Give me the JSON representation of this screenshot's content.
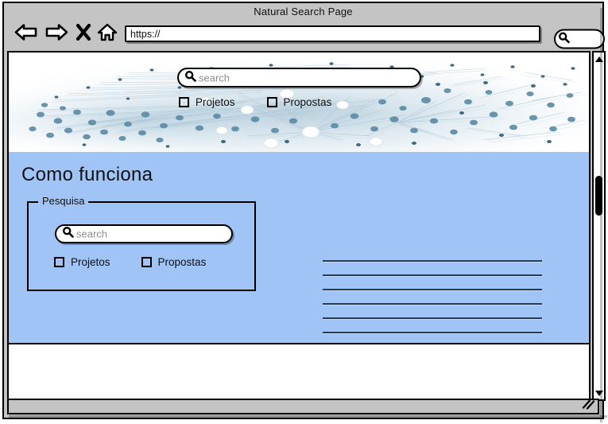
{
  "window": {
    "title": "Natural Search Page"
  },
  "browser_chrome": {
    "back_icon": "back-arrow-icon",
    "forward_icon": "forward-arrow-icon",
    "stop_icon": "close-x-icon",
    "home_icon": "home-icon",
    "url_value": "https://",
    "url_placeholder": "https://",
    "search_icon": "search-icon",
    "search_value": "",
    "search_placeholder": ""
  },
  "hero": {
    "background_image": "network-graph-visualization",
    "search": {
      "icon": "search-icon",
      "value": "",
      "placeholder": "search"
    },
    "checkboxes": [
      {
        "label": "Projetos",
        "checked": false
      },
      {
        "label": "Propostas",
        "checked": false
      }
    ]
  },
  "section": {
    "title": "Como funciona",
    "background_color": "#a0c4f6",
    "fieldset": {
      "legend": "Pesquisa",
      "search": {
        "icon": "search-icon",
        "value": "",
        "placeholder": "search"
      },
      "checkboxes": [
        {
          "label": "Projetos",
          "checked": false
        },
        {
          "label": "Propostas",
          "checked": false
        }
      ]
    },
    "text_lines": [
      1,
      2,
      3,
      4,
      5,
      6
    ]
  },
  "scrollbar": {
    "up_icon": "triangle-up-icon",
    "down_icon": "triangle-down-icon",
    "thumb": "scrollbar-thumb"
  },
  "status_bar": {
    "resize_icon": "resize-grip-icon"
  }
}
